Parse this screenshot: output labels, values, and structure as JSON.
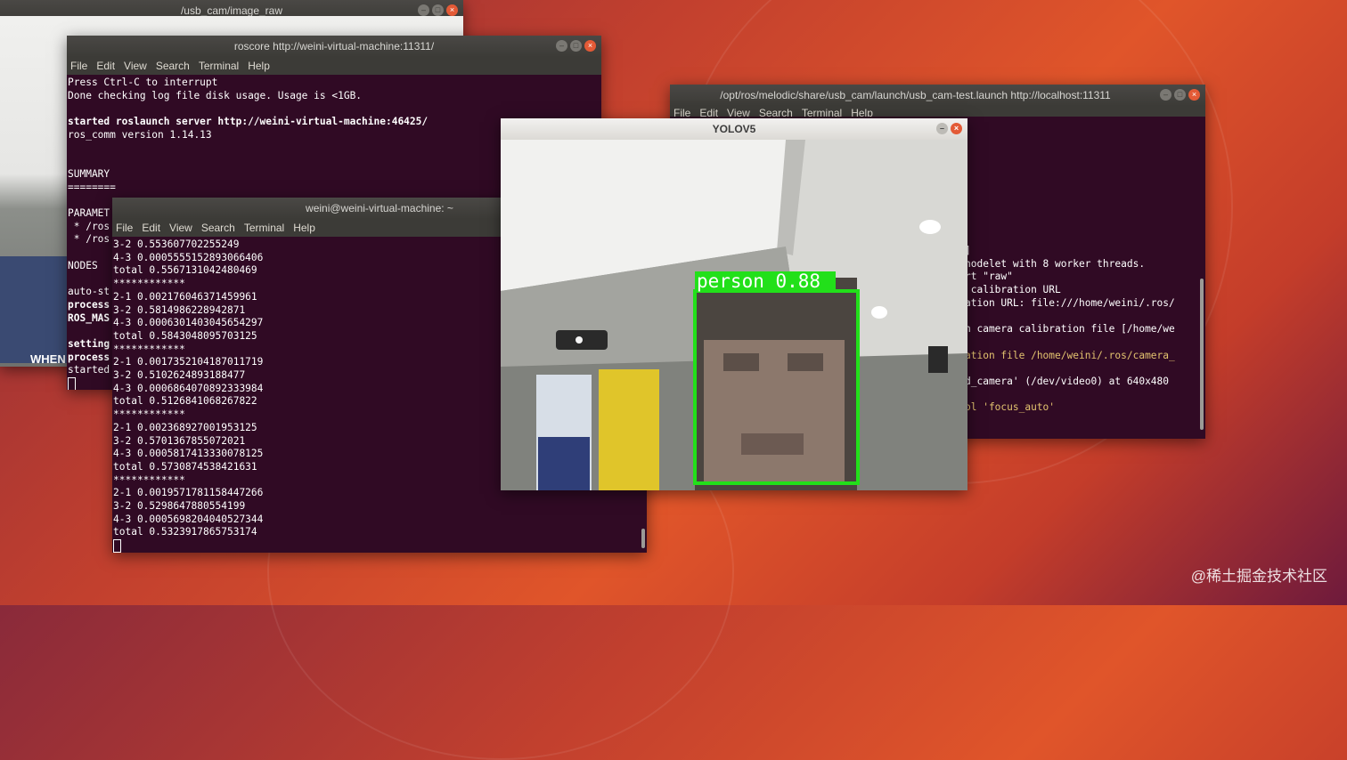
{
  "windows": {
    "image_raw": {
      "title": "/usb_cam/image_raw"
    },
    "roscore": {
      "title": "roscore http://weini-virtual-machine:11311/",
      "menu": [
        "File",
        "Edit",
        "View",
        "Search",
        "Terminal",
        "Help"
      ],
      "lines": [
        "Press Ctrl-C to interrupt",
        "Done checking log file disk usage. Usage is <1GB.",
        "",
        "started roslaunch server http://weini-virtual-machine:46425/",
        "ros_comm version 1.14.13",
        "",
        "",
        "SUMMARY",
        "========",
        "",
        "PARAMET",
        " * /ros",
        " * /ros",
        "",
        "NODES",
        "",
        "auto-st",
        "process",
        "ROS_MAS",
        "",
        "setting",
        "process",
        "started"
      ]
    },
    "weini": {
      "title": "weini@weini-virtual-machine: ~",
      "menu": [
        "File",
        "Edit",
        "View",
        "Search",
        "Terminal",
        "Help"
      ],
      "lines": [
        "3-2 0.553607702255249",
        "4-3 0.0005555152893066406",
        "total 0.5567131042480469",
        "************",
        "2-1 0.002176046371459961",
        "3-2 0.5814986228942871",
        "4-3 0.0006301403045654297",
        "total 0.5843048095703125",
        "************",
        "2-1 0.0017352104187011719",
        "3-2 0.5102624893188477",
        "4-3 0.0006864070892333984",
        "total 0.5126841068267822",
        "************",
        "2-1 0.002368927001953125",
        "3-2 0.5701367855072021",
        "4-3 0.0005817413330078125",
        "total 0.5730874538421631",
        "************",
        "2-1 0.0019571781158447266",
        "3-2 0.5298647880554199",
        "4-3 0.0005698204040527344",
        "total 0.5323917865753174"
      ]
    },
    "usbcam_launch": {
      "title": "/opt/ros/melodic/share/usb_cam/launch/usb_cam-test.launch http://localhost:11311",
      "menu": [
        "File",
        "Edit",
        "View",
        "Search",
        "Terminal",
        "Help"
      ],
      "lines": [
        {
          "t": "]",
          "c": "w"
        },
        {
          "t": "nodelet with 8 worker threads.",
          "c": "w"
        },
        {
          "t": "rt \"raw\"",
          "c": "w"
        },
        {
          "t": " calibration URL",
          "c": "w"
        },
        {
          "t": "ation URL: file:///home/weini/.ros/",
          "c": "w"
        },
        {
          "t": "",
          "c": "w"
        },
        {
          "t": "n camera calibration file [/home/we",
          "c": "w"
        },
        {
          "t": "",
          "c": "w"
        },
        {
          "t": "ation file /home/weini/.ros/camera_",
          "c": "y"
        },
        {
          "t": "",
          "c": "w"
        },
        {
          "t": "d_camera' (/dev/video0) at 640x480",
          "c": "w"
        },
        {
          "t": "",
          "c": "w"
        },
        {
          "t": "ol 'focus_auto'",
          "c": "y"
        }
      ]
    },
    "yolov5": {
      "title": "YOLOV5",
      "detection": {
        "label": "person 0.88",
        "color": "#22e01a"
      }
    }
  },
  "camera_poster_text": "WHEN",
  "watermark": "@稀土掘金技术社区"
}
